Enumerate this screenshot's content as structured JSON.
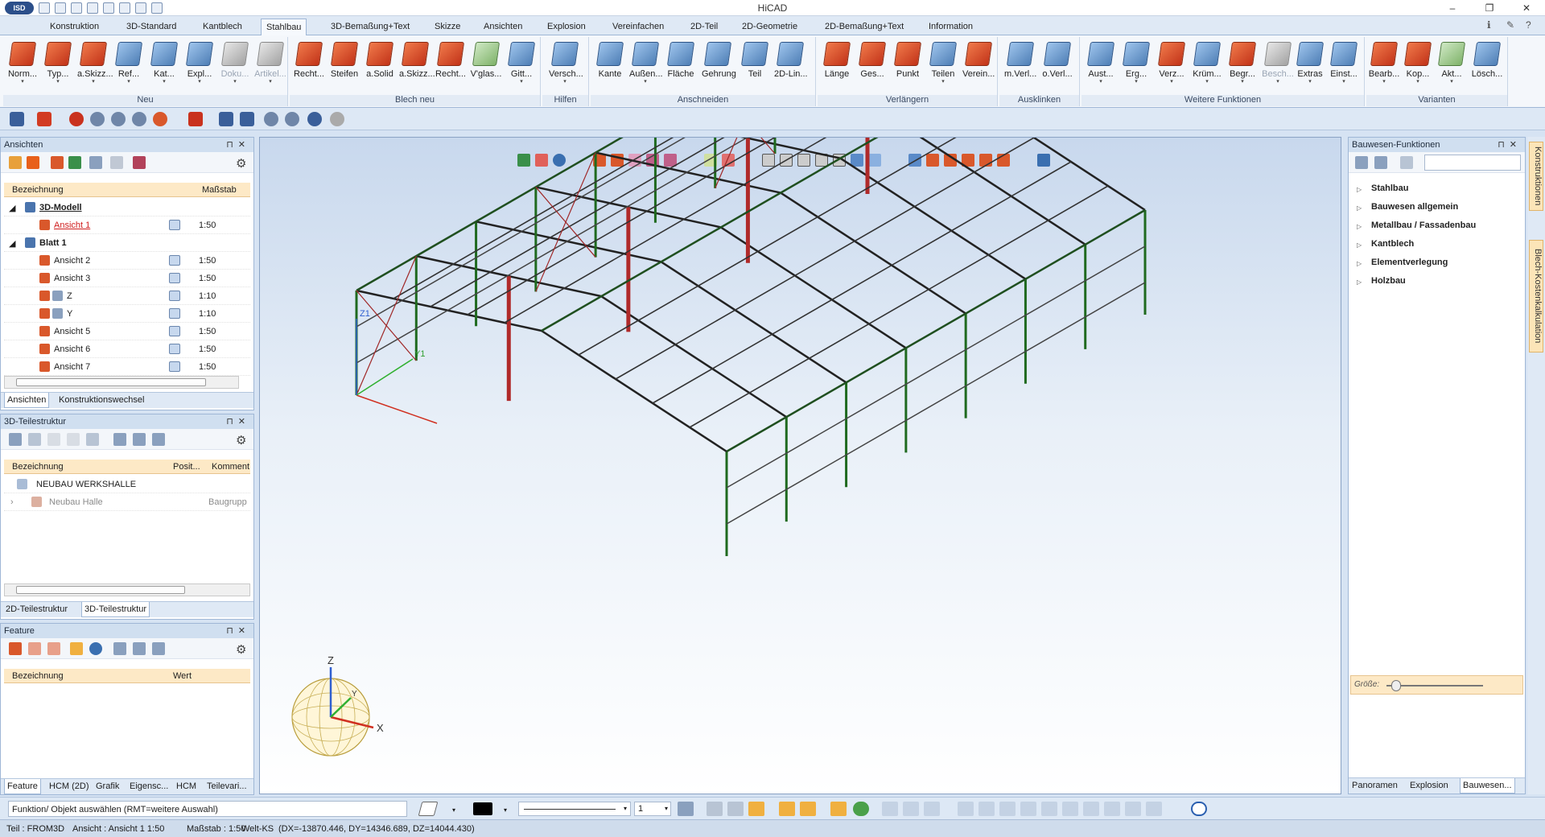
{
  "app": {
    "title": "HiCAD",
    "logo": "ISD"
  },
  "window_controls": [
    "–",
    "❐",
    "✕"
  ],
  "tabs": [
    {
      "label": "Konstruktion"
    },
    {
      "label": "3D-Standard"
    },
    {
      "label": "Kantblech"
    },
    {
      "label": "Stahlbau",
      "active": true
    },
    {
      "label": "3D-Bemaßung+Text"
    },
    {
      "label": "Skizze"
    },
    {
      "label": "Ansichten"
    },
    {
      "label": "Explosion"
    },
    {
      "label": "Vereinfachen"
    },
    {
      "label": "2D-Teil"
    },
    {
      "label": "2D-Geometrie"
    },
    {
      "label": "2D-Bemaßung+Text"
    },
    {
      "label": "Information"
    }
  ],
  "ribbon": {
    "groups": [
      {
        "label": "Neu",
        "buttons": [
          "Norm...",
          "Typ...",
          "a.Skizz...",
          "Ref...",
          "Kat...",
          "Expl...",
          "Doku...",
          "Artikel..."
        ]
      },
      {
        "label": "Blech neu",
        "buttons": [
          "Recht...",
          "Steifen",
          "a.Solid",
          "a.Skizz...",
          "Recht...",
          "V'glas...",
          "Gitt..."
        ]
      },
      {
        "label": "Hilfen",
        "buttons": [
          "Versch..."
        ]
      },
      {
        "label": "Anschneiden",
        "buttons": [
          "Kante",
          "Außen...",
          "Fläche",
          "Gehrung",
          "Teil",
          "2D-Lin..."
        ]
      },
      {
        "label": "Verlängern",
        "buttons": [
          "Länge",
          "Ges...",
          "Punkt",
          "Teilen",
          "Verein..."
        ]
      },
      {
        "label": "Ausklinken",
        "buttons": [
          "m.Verl...",
          "o.Verl..."
        ]
      },
      {
        "label": "Weitere Funktionen",
        "buttons": [
          "Aust...",
          "Erg...",
          "Verz...",
          "Krüm...",
          "Begr...",
          "Besch...",
          "Extras",
          "Einst..."
        ]
      },
      {
        "label": "Varianten",
        "buttons": [
          "Bearb...",
          "Kop...",
          "Akt...",
          "Lösch..."
        ]
      }
    ]
  },
  "ansichten_panel": {
    "title": "Ansichten",
    "headers": {
      "name": "Bezeichnung",
      "scale": "Maßstab"
    },
    "rows": [
      {
        "name": "3D-Modell",
        "scale": ""
      },
      {
        "name": "Ansicht 1",
        "scale": "1:50"
      },
      {
        "name": "Blatt 1",
        "scale": ""
      },
      {
        "name": "Ansicht 2",
        "scale": "1:50"
      },
      {
        "name": "Ansicht 3",
        "scale": "1:50"
      },
      {
        "name": "Z",
        "scale": "1:10"
      },
      {
        "name": "Y",
        "scale": "1:10"
      },
      {
        "name": "Ansicht 5",
        "scale": "1:50"
      },
      {
        "name": "Ansicht 6",
        "scale": "1:50"
      },
      {
        "name": "Ansicht 7",
        "scale": "1:50"
      }
    ],
    "tabs": [
      "Ansichten",
      "Konstruktionswechsel"
    ]
  },
  "struktur_panel": {
    "title": "3D-Teilestruktur",
    "headers": {
      "name": "Bezeichnung",
      "pos": "Posit...",
      "comment": "Komment"
    },
    "rows": [
      {
        "name": "NEUBAU WERKSHALLE",
        "pos": "",
        "comment": ""
      },
      {
        "name": "Neubau Halle",
        "pos": "",
        "comment": "Baugrupp"
      }
    ],
    "tabs": [
      "2D-Teilestruktur",
      "3D-Teilestruktur"
    ]
  },
  "feature_panel": {
    "title": "Feature",
    "headers": {
      "name": "Bezeichnung",
      "value": "Wert"
    },
    "tabs": [
      "Feature",
      "HCM (2D)",
      "Grafik",
      "Eigensc...",
      "HCM",
      "Teilevari..."
    ]
  },
  "viewport": {
    "axis_labels": {
      "x": "X",
      "y": "Y",
      "z": "Z",
      "y1": "Y1",
      "z1": "Z1"
    }
  },
  "bauwesen_panel": {
    "title": "Bauwesen-Funktionen",
    "items": [
      "Stahlbau",
      "Bauwesen allgemein",
      "Metallbau / Fassadenbau",
      "Kantblech",
      "Elementverlegung",
      "Holzbau"
    ],
    "size_label": "Größe:",
    "tabs": [
      "Panoramen",
      "Explosion",
      "Bauwesen..."
    ]
  },
  "side_tabs": [
    "Konstruktionen",
    "Blech-Kostenkalkulation"
  ],
  "bottom": {
    "command": "Funktion/ Objekt auswählen (RMT=weitere Auswahl)",
    "line_width": "1"
  },
  "status": {
    "part": "Teil : FROM3D",
    "view": "Ansicht : Ansicht 1 1:50",
    "scale": "Maßstab : 1:50",
    "ks": "Welt-KS",
    "coords": "(DX=-13870.446, DY=14346.689, DZ=14044.430)"
  }
}
